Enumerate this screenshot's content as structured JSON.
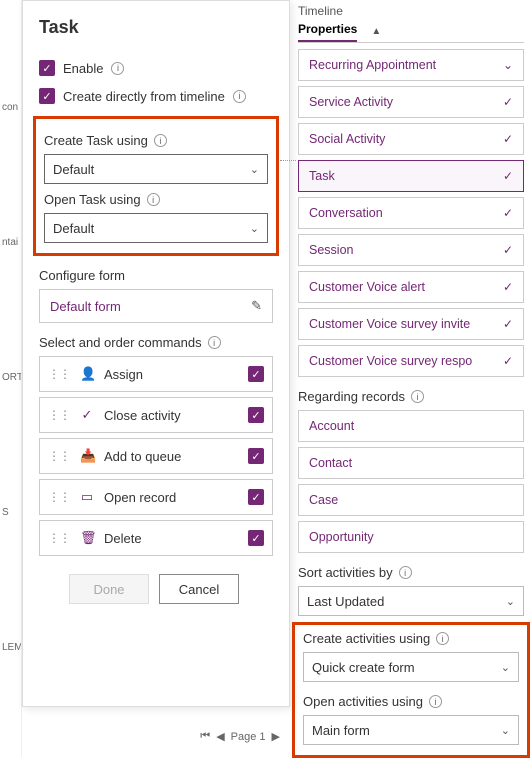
{
  "gutter": {
    "a": "con",
    "b": "ntai",
    "c": "ORT",
    "d": "S",
    "e": "LEM"
  },
  "task": {
    "title": "Task",
    "enable": "Enable",
    "direct": "Create directly from timeline",
    "create_label": "Create Task using",
    "create_value": "Default",
    "open_label": "Open Task using",
    "open_value": "Default",
    "configure": "Configure form",
    "default_form": "Default form",
    "select_cmds": "Select and order commands",
    "cmds": {
      "assign": "Assign",
      "close": "Close activity",
      "queue": "Add to queue",
      "open": "Open record",
      "delete": "Delete"
    },
    "done": "Done",
    "cancel": "Cancel"
  },
  "pager": {
    "label": "Page 1"
  },
  "tabs": {
    "timeline": "Timeline",
    "properties": "Properties"
  },
  "activities": {
    "recurring": "Recurring Appointment",
    "service": "Service Activity",
    "social": "Social Activity",
    "task": "Task",
    "conversation": "Conversation",
    "session": "Session",
    "cva": "Customer Voice alert",
    "cvi": "Customer Voice survey invite",
    "cvr": "Customer Voice survey respo"
  },
  "regarding": {
    "label": "Regarding records",
    "account": "Account",
    "contact": "Contact",
    "case": "Case",
    "opportunity": "Opportunity"
  },
  "sort": {
    "label": "Sort activities by",
    "value": "Last Updated"
  },
  "createAct": {
    "label": "Create activities using",
    "value": "Quick create form"
  },
  "openAct": {
    "label": "Open activities using",
    "value": "Main form"
  }
}
